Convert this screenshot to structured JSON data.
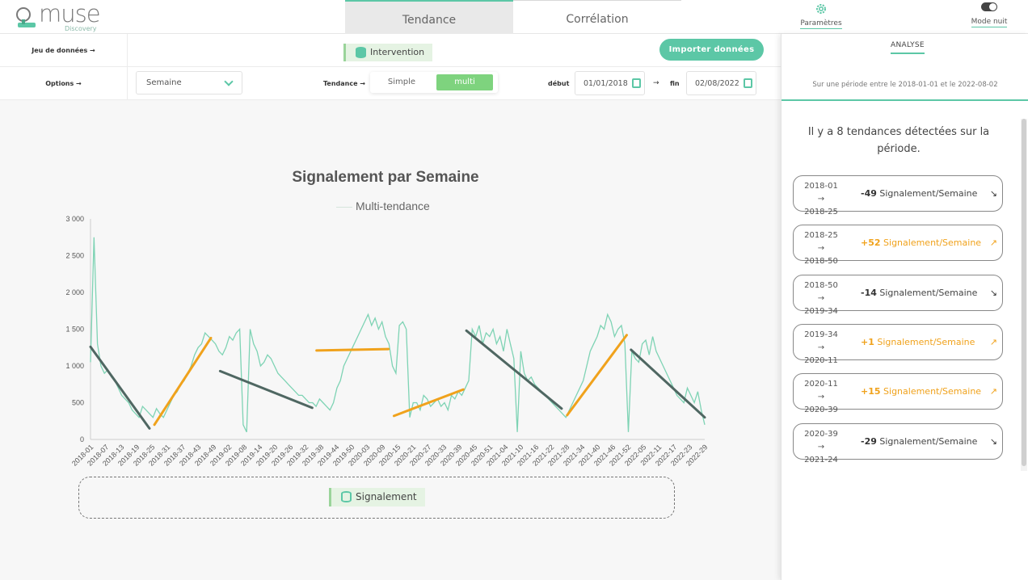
{
  "app": {
    "logo_text": "muse",
    "logo_sub": "Discovery"
  },
  "nav": {
    "tabs": [
      {
        "label": "Tendance"
      },
      {
        "label": "Corrélation"
      }
    ],
    "settings_label": "Paramètres",
    "night_mode_label": "Mode nuit"
  },
  "controls": {
    "dataset_label": "Jeu de données →",
    "options_label": "Options →",
    "intervention_chip": "Intervention",
    "import_button": "Importer données",
    "period_select": "Semaine",
    "trend_label": "Tendance →",
    "trend_options": [
      "Simple",
      "multi"
    ],
    "trend_selected": "multi",
    "start_label": "début",
    "start_value": "01/01/2018",
    "dates_arrow": "→",
    "end_label": "fin",
    "end_value": "02/08/2022"
  },
  "chart_data": {
    "type": "line",
    "title": "Signalement par Semaine",
    "series_name": "Multi-tendance",
    "ylim": [
      0,
      3000
    ],
    "yticks": [
      "0",
      "500",
      "1 000",
      "1 500",
      "2 000",
      "2 500",
      "3 000"
    ],
    "xticks": [
      "2018-01",
      "2018-07",
      "2018-13",
      "2018-19",
      "2018-25",
      "2018-31",
      "2018-37",
      "2018-43",
      "2018-49",
      "2019-02",
      "2019-08",
      "2019-14",
      "2019-20",
      "2019-26",
      "2019-32",
      "2019-38",
      "2019-44",
      "2019-50",
      "2020-03",
      "2020-09",
      "2020-15",
      "2020-21",
      "2020-27",
      "2020-33",
      "2020-39",
      "2020-45",
      "2020-51",
      "2021-04",
      "2021-10",
      "2021-16",
      "2021-22",
      "2021-28",
      "2021-34",
      "2021-40",
      "2021-46",
      "2021-52",
      "2022-05",
      "2022-11",
      "2022-17",
      "2022-23",
      "2022-29"
    ],
    "series": [
      {
        "name": "Signalement",
        "values": [
          1050,
          2750,
          1300,
          1000,
          900,
          950,
          850,
          800,
          700,
          600,
          550,
          500,
          400,
          350,
          300,
          450,
          400,
          350,
          300,
          420,
          350,
          300,
          400,
          500,
          600,
          650,
          750,
          800,
          900,
          1000,
          1150,
          1250,
          1300,
          1450,
          1400,
          1350,
          1300,
          1200,
          1150,
          1250,
          1400,
          1350,
          1450,
          1500,
          200,
          100,
          1500,
          1300,
          1200,
          1000,
          1050,
          1150,
          1100,
          1000,
          900,
          850,
          800,
          750,
          700,
          650,
          600,
          600,
          550,
          500,
          500,
          450,
          550,
          500,
          450,
          400,
          500,
          700,
          800,
          1000,
          1100,
          1200,
          1300,
          1400,
          1500,
          1600,
          1700,
          1550,
          1650,
          1500,
          1600,
          1400,
          1300,
          1000,
          900,
          1550,
          1600,
          1500,
          300,
          500,
          500,
          400,
          600,
          550,
          450,
          500,
          550,
          450,
          500,
          400,
          600,
          550,
          650,
          600,
          700,
          800,
          1500,
          1400,
          1550,
          1300,
          1450,
          1400,
          1500,
          1300,
          1400,
          1200,
          1500,
          1300,
          1100,
          100,
          1200,
          900,
          800,
          850,
          750,
          700,
          650,
          600,
          550,
          500,
          450,
          400,
          350,
          300,
          400,
          500,
          600,
          700,
          800,
          1000,
          1200,
          1300,
          1400,
          1550,
          1500,
          1700,
          1600,
          1400,
          1500,
          1550,
          1300,
          100,
          1200,
          1100,
          1050,
          1300,
          1350,
          1150,
          1400,
          1200,
          1100,
          1000,
          900,
          800,
          700,
          600,
          550,
          500,
          700,
          600,
          500,
          650,
          400,
          200
        ]
      }
    ],
    "trends": [
      {
        "x0": 0.0,
        "x1": 0.096,
        "y0": 1260,
        "y1": 150,
        "dir": "neg"
      },
      {
        "x0": 0.104,
        "x1": 0.196,
        "y0": 200,
        "y1": 1380,
        "dir": "pos"
      },
      {
        "x0": 0.211,
        "x1": 0.361,
        "y0": 930,
        "y1": 430,
        "dir": "neg"
      },
      {
        "x0": 0.368,
        "x1": 0.485,
        "y0": 1210,
        "y1": 1230,
        "dir": "pos"
      },
      {
        "x0": 0.494,
        "x1": 0.607,
        "y0": 320,
        "y1": 680,
        "dir": "pos"
      },
      {
        "x0": 0.612,
        "x1": 0.767,
        "y0": 1480,
        "y1": 420,
        "dir": "neg"
      },
      {
        "x0": 0.776,
        "x1": 0.873,
        "y0": 330,
        "y1": 1420,
        "dir": "pos"
      },
      {
        "x0": 0.88,
        "x1": 1.0,
        "y0": 1220,
        "y1": 300,
        "dir": "neg"
      }
    ],
    "line_color": "#7ed3b4",
    "neg_color": "#4f6762",
    "pos_color": "#f0a21c"
  },
  "dropzone": {
    "chip": "Signalement"
  },
  "panel": {
    "tab": "ANALYSE",
    "period": "Sur une période entre le 2018-01-01 et le 2022-08-02",
    "summary": "Il y a 8 tendances détectées sur la période.",
    "trends": [
      {
        "from": "2018-01 →",
        "to": "2018-25",
        "value": "-49",
        "unit": "Signalement/Semaine",
        "dir": "neg"
      },
      {
        "from": "2018-25 →",
        "to": "2018-50",
        "value": "+52",
        "unit": "Signalement/Semaine",
        "dir": "pos"
      },
      {
        "from": "2018-50 →",
        "to": "2019-34",
        "value": "-14",
        "unit": "Signalement/Semaine",
        "dir": "neg"
      },
      {
        "from": "2019-34 →",
        "to": "2020-11",
        "value": "+1",
        "unit": "Signalement/Semaine",
        "dir": "pos"
      },
      {
        "from": "2020-11 →",
        "to": "2020-39",
        "value": "+15",
        "unit": "Signalement/Semaine",
        "dir": "pos"
      },
      {
        "from": "2020-39 →",
        "to": "2021-24",
        "value": "-29",
        "unit": "Signalement/Semaine",
        "dir": "neg"
      }
    ]
  }
}
